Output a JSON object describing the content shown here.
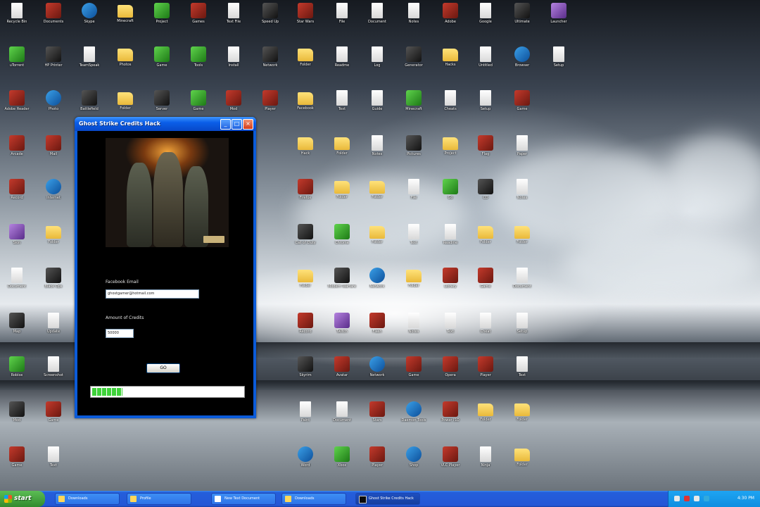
{
  "window": {
    "title": "Ghost Strike Credits Hack",
    "email_label": "Facebook Email",
    "email_value": "ghostgamer@hotmail.com",
    "amount_label": "Amount of Credits",
    "amount_value": "50000",
    "go_label": "GO",
    "progress": 0.2
  },
  "taskbar": {
    "start_label": "start",
    "tasks": [
      "Downloads",
      "Profile",
      "New Text Document",
      "Downloads",
      "Ghost Strike Credits Hack"
    ],
    "clock": "4:30 PM"
  },
  "icons": [
    {
      "label": "Recycle Bin",
      "kind": "doc"
    },
    {
      "label": "Documents",
      "kind": "app"
    },
    {
      "label": "Skype",
      "kind": "blue"
    },
    {
      "label": "Minecraft",
      "kind": "folder"
    },
    {
      "label": "Project",
      "kind": "green"
    },
    {
      "label": "Games",
      "kind": "app"
    },
    {
      "label": "Text File",
      "kind": "doc"
    },
    {
      "label": "Speed Up",
      "kind": "dark"
    },
    {
      "label": "Star Wars",
      "kind": "app"
    },
    {
      "label": "File",
      "kind": "doc"
    },
    {
      "label": "Document",
      "kind": "doc"
    },
    {
      "label": "Notes",
      "kind": "doc"
    },
    {
      "label": "Adobe",
      "kind": "app"
    },
    {
      "label": "Google",
      "kind": "doc"
    },
    {
      "label": "Ultimate",
      "kind": "dark"
    },
    {
      "label": "Launcher",
      "kind": "purple"
    },
    {
      "label": "uTorrent",
      "kind": "green"
    },
    {
      "label": "HP Printer",
      "kind": "dark"
    },
    {
      "label": "TeamSpeak",
      "kind": "doc"
    },
    {
      "label": "Photos",
      "kind": "folder"
    },
    {
      "label": "Game",
      "kind": "green"
    },
    {
      "label": "Tools",
      "kind": "green"
    },
    {
      "label": "Install",
      "kind": "doc"
    },
    {
      "label": "Network",
      "kind": "dark"
    },
    {
      "label": "Folder",
      "kind": "folder"
    },
    {
      "label": "Readme",
      "kind": "doc"
    },
    {
      "label": "Log",
      "kind": "doc"
    },
    {
      "label": "Generator",
      "kind": "dark"
    },
    {
      "label": "Hacks",
      "kind": "folder"
    },
    {
      "label": "Untitled",
      "kind": "doc"
    },
    {
      "label": "Browser",
      "kind": "blue"
    },
    {
      "label": "Setup",
      "kind": "doc"
    },
    {
      "label": "Adobe Reader",
      "kind": "app"
    },
    {
      "label": "Photo",
      "kind": "blue"
    },
    {
      "label": "Battlefield",
      "kind": "dark"
    },
    {
      "label": "Folder",
      "kind": "folder"
    },
    {
      "label": "Server",
      "kind": "dark"
    },
    {
      "label": "Game",
      "kind": "green"
    },
    {
      "label": "Mod",
      "kind": "app"
    },
    {
      "label": "Player",
      "kind": "app"
    },
    {
      "label": "Facebook",
      "kind": "folder"
    },
    {
      "label": "Text",
      "kind": "doc"
    },
    {
      "label": "Guide",
      "kind": "doc"
    },
    {
      "label": "Minecraft",
      "kind": "green"
    },
    {
      "label": "Cheats",
      "kind": "doc"
    },
    {
      "label": "Setup",
      "kind": "doc"
    },
    {
      "label": "Game",
      "kind": "app"
    },
    {
      "label": "Arcade",
      "kind": "app"
    },
    {
      "label": "Mail",
      "kind": "app"
    },
    {
      "label": "Hack",
      "kind": "folder"
    },
    {
      "label": "Folder",
      "kind": "folder"
    },
    {
      "label": "Notes",
      "kind": "doc"
    },
    {
      "label": "Pictures",
      "kind": "dark"
    },
    {
      "label": "Project",
      "kind": "folder"
    },
    {
      "label": "Flag",
      "kind": "app"
    },
    {
      "label": "Paper",
      "kind": "doc"
    },
    {
      "label": "Record",
      "kind": "app"
    },
    {
      "label": "Internet",
      "kind": "blue"
    },
    {
      "label": "Firefox",
      "kind": "app"
    },
    {
      "label": "Folder",
      "kind": "folder"
    },
    {
      "label": "Folder",
      "kind": "folder"
    },
    {
      "label": "File",
      "kind": "doc"
    },
    {
      "label": "Go",
      "kind": "green"
    },
    {
      "label": "CD",
      "kind": "dark"
    },
    {
      "label": "Notes",
      "kind": "doc"
    },
    {
      "label": "Skin",
      "kind": "purple"
    },
    {
      "label": "Folder",
      "kind": "folder"
    },
    {
      "label": "Call of Duty",
      "kind": "dark"
    },
    {
      "label": "Chrome",
      "kind": "green"
    },
    {
      "label": "Folder",
      "kind": "folder"
    },
    {
      "label": "Text",
      "kind": "doc"
    },
    {
      "label": "Readme",
      "kind": "doc"
    },
    {
      "label": "Folder",
      "kind": "folder"
    },
    {
      "label": "Folder",
      "kind": "folder"
    },
    {
      "label": "Document",
      "kind": "doc"
    },
    {
      "label": "Black Ops",
      "kind": "dark"
    },
    {
      "label": "Folder",
      "kind": "folder"
    },
    {
      "label": "Modern Warfare",
      "kind": "dark"
    },
    {
      "label": "Network",
      "kind": "blue"
    },
    {
      "label": "Folder",
      "kind": "folder"
    },
    {
      "label": "Library",
      "kind": "app"
    },
    {
      "label": "Game",
      "kind": "app"
    },
    {
      "label": "Document",
      "kind": "doc"
    },
    {
      "label": "Map",
      "kind": "dark"
    },
    {
      "label": "Update",
      "kind": "doc"
    },
    {
      "label": "Record",
      "kind": "app"
    },
    {
      "label": "Twitch",
      "kind": "purple"
    },
    {
      "label": "Flash",
      "kind": "app"
    },
    {
      "label": "Notes",
      "kind": "doc"
    },
    {
      "label": "Text",
      "kind": "doc"
    },
    {
      "label": "Cheat",
      "kind": "doc"
    },
    {
      "label": "Setup",
      "kind": "doc"
    },
    {
      "label": "Roblox",
      "kind": "green"
    },
    {
      "label": "Screenshot",
      "kind": "doc"
    },
    {
      "label": "Skyrim",
      "kind": "dark"
    },
    {
      "label": "Avatar",
      "kind": "app"
    },
    {
      "label": "Network",
      "kind": "blue"
    },
    {
      "label": "Game",
      "kind": "app"
    },
    {
      "label": "Opera",
      "kind": "app"
    },
    {
      "label": "Player",
      "kind": "app"
    },
    {
      "label": "Text",
      "kind": "doc"
    },
    {
      "label": "Mod",
      "kind": "dark"
    },
    {
      "label": "Game",
      "kind": "app"
    },
    {
      "label": "Paint",
      "kind": "doc"
    },
    {
      "label": "Document",
      "kind": "doc"
    },
    {
      "label": "Stars",
      "kind": "app"
    },
    {
      "label": "Daemon Tools",
      "kind": "blue"
    },
    {
      "label": "Power ISO",
      "kind": "app"
    },
    {
      "label": "Folder",
      "kind": "folder"
    },
    {
      "label": "Folder",
      "kind": "folder"
    },
    {
      "label": "Game",
      "kind": "app"
    },
    {
      "label": "Text",
      "kind": "doc"
    },
    {
      "label": "Word",
      "kind": "blue"
    },
    {
      "label": "Xbox",
      "kind": "green"
    },
    {
      "label": "Player",
      "kind": "app"
    },
    {
      "label": "Shop",
      "kind": "blue"
    },
    {
      "label": "VLC Player",
      "kind": "app"
    },
    {
      "label": "Ninja",
      "kind": "doc"
    },
    {
      "label": "Folder",
      "kind": "folder"
    },
    {
      "label": "Cheat",
      "kind": "doc"
    },
    {
      "label": "Game",
      "kind": "app"
    },
    {
      "label": "Tool",
      "kind": "dark"
    },
    {
      "label": "Cards",
      "kind": "blue"
    },
    {
      "label": "Spider",
      "kind": "app"
    },
    {
      "label": "Document",
      "kind": "doc"
    },
    {
      "label": "Stats",
      "kind": "dark"
    },
    {
      "label": "Paint",
      "kind": "doc"
    },
    {
      "label": "Globe",
      "kind": "purple"
    },
    {
      "label": "Text",
      "kind": "doc"
    },
    {
      "label": "File",
      "kind": "doc"
    },
    {
      "label": "Notes",
      "kind": "doc"
    }
  ]
}
